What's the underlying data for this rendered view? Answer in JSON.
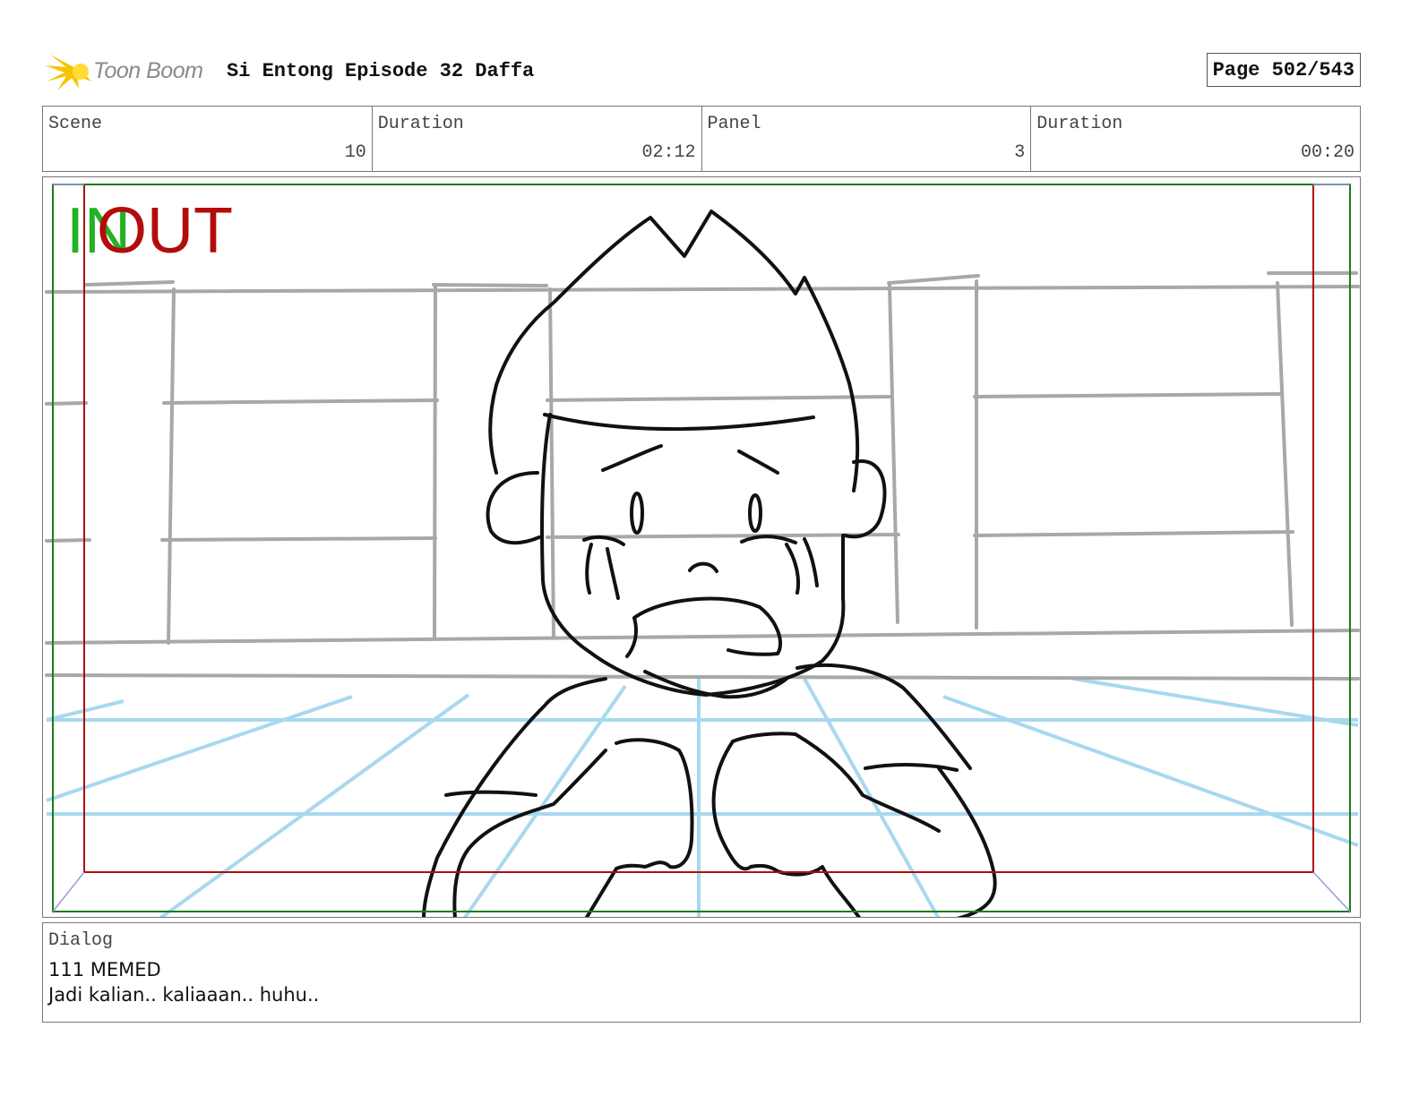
{
  "header": {
    "logo_text": "Toon Boom",
    "title": "Si Entong Episode 32 Daffa",
    "page": "Page 502/543"
  },
  "info": {
    "scene_label": "Scene",
    "scene_value": "10",
    "scene_duration_label": "Duration",
    "scene_duration_value": "02:12",
    "panel_label": "Panel",
    "panel_value": "3",
    "panel_duration_label": "Duration",
    "panel_duration_value": "00:20"
  },
  "panel": {
    "in_label": "IN",
    "out_label": "OUT"
  },
  "dialog": {
    "label": "Dialog",
    "line1": "111 MEMED",
    "line2": "Jadi kalian.. kaliaaan.. huhu.."
  },
  "colors": {
    "in_green": "#22b222",
    "out_red": "#b20d0d",
    "logo_yellow": "#f5c400",
    "guide_blue": "#a8d8f0",
    "guide_gray": "#a8a8a8"
  }
}
